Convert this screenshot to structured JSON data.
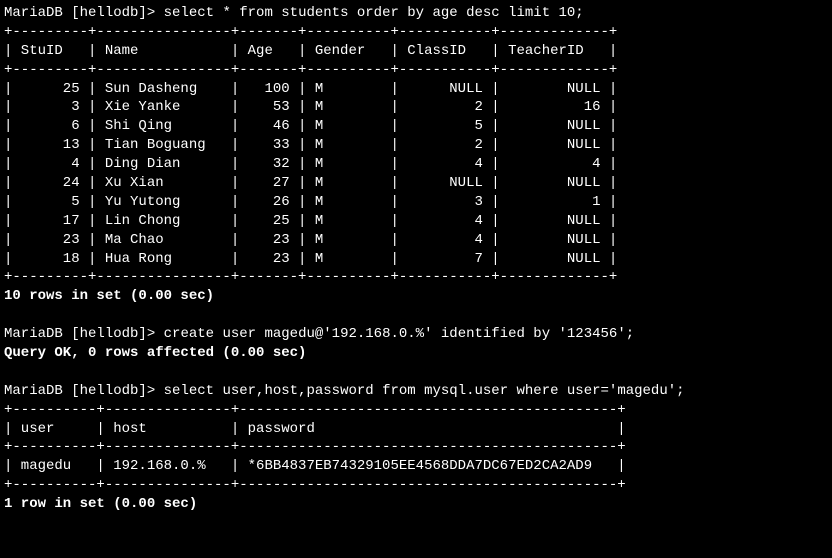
{
  "prompt_db": "MariaDB [hellodb]",
  "queries": {
    "q1": "select * from students order by age desc limit 10;",
    "q2": "create user magedu@'192.168.0.%' identified by '123456';",
    "q3": "select user,host,password from mysql.user where user='magedu';"
  },
  "table1": {
    "columns": [
      "StuID",
      "Name",
      "Age",
      "Gender",
      "ClassID",
      "TeacherID"
    ],
    "widths": [
      7,
      14,
      5,
      8,
      9,
      11
    ],
    "align": [
      "right",
      "left",
      "right",
      "left",
      "right",
      "right"
    ],
    "rows": [
      [
        "25",
        "Sun Dasheng",
        "100",
        "M",
        "NULL",
        "NULL"
      ],
      [
        "3",
        "Xie Yanke",
        "53",
        "M",
        "2",
        "16"
      ],
      [
        "6",
        "Shi Qing",
        "46",
        "M",
        "5",
        "NULL"
      ],
      [
        "13",
        "Tian Boguang",
        "33",
        "M",
        "2",
        "NULL"
      ],
      [
        "4",
        "Ding Dian",
        "32",
        "M",
        "4",
        "4"
      ],
      [
        "24",
        "Xu Xian",
        "27",
        "M",
        "NULL",
        "NULL"
      ],
      [
        "5",
        "Yu Yutong",
        "26",
        "M",
        "3",
        "1"
      ],
      [
        "17",
        "Lin Chong",
        "25",
        "M",
        "4",
        "NULL"
      ],
      [
        "23",
        "Ma Chao",
        "23",
        "M",
        "4",
        "NULL"
      ],
      [
        "18",
        "Hua Rong",
        "23",
        "M",
        "7",
        "NULL"
      ]
    ]
  },
  "results": {
    "r1": "10 rows in set (0.00 sec)",
    "r2": "Query OK, 0 rows affected (0.00 sec)",
    "r3": "1 row in set (0.00 sec)"
  },
  "table2": {
    "columns": [
      "user",
      "host",
      "password"
    ],
    "widths": [
      8,
      13,
      43
    ],
    "align": [
      "left",
      "left",
      "left"
    ],
    "rows": [
      [
        "magedu",
        "192.168.0.%",
        "*6BB4837EB74329105EE4568DDA7DC67ED2CA2AD9"
      ]
    ]
  },
  "lines": {}
}
